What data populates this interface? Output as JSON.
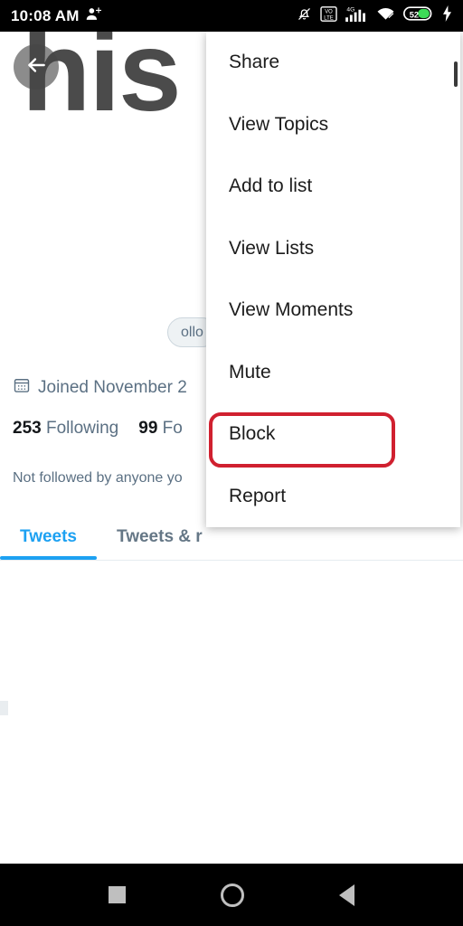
{
  "statusbar": {
    "clock": "10:08 AM",
    "icons": {
      "add_person": "add-person-icon",
      "notifications_off": "notifications-off-icon",
      "volte": "volte-icon",
      "volte_top": "VO",
      "volte_bottom": "LTE",
      "network": "4G",
      "signal": "signal-bars-icon",
      "wifi": "wifi-icon",
      "battery": "battery-icon",
      "battery_level": "52",
      "charging": "charging-bolt-icon"
    }
  },
  "profile": {
    "banner_text": "his",
    "back_icon": "back-arrow-icon",
    "follow_button_label": "ollo",
    "calendar_icon": "calendar-icon",
    "joined": "Joined November 2",
    "following_count": "253",
    "following_label": "Following",
    "followers_count": "99",
    "followers_label": "Fo",
    "not_followed": "Not followed by anyone yo",
    "tabs": [
      {
        "label": "Tweets",
        "active": true
      },
      {
        "label": "Tweets & r",
        "active": false
      }
    ]
  },
  "menu": {
    "items": [
      {
        "label": "Share"
      },
      {
        "label": "View Topics"
      },
      {
        "label": "Add to list"
      },
      {
        "label": "View Lists"
      },
      {
        "label": "View Moments"
      },
      {
        "label": "Mute"
      },
      {
        "label": "Block"
      },
      {
        "label": "Report"
      }
    ],
    "highlighted_item": "Block",
    "highlight_color": "#d0202f"
  },
  "navbar": {
    "recents": "recents-square-icon",
    "home": "home-circle-icon",
    "back": "back-triangle-icon"
  },
  "colors": {
    "accent": "#1da1f2",
    "muted_text": "#5b7083",
    "highlight": "#d0202f"
  }
}
